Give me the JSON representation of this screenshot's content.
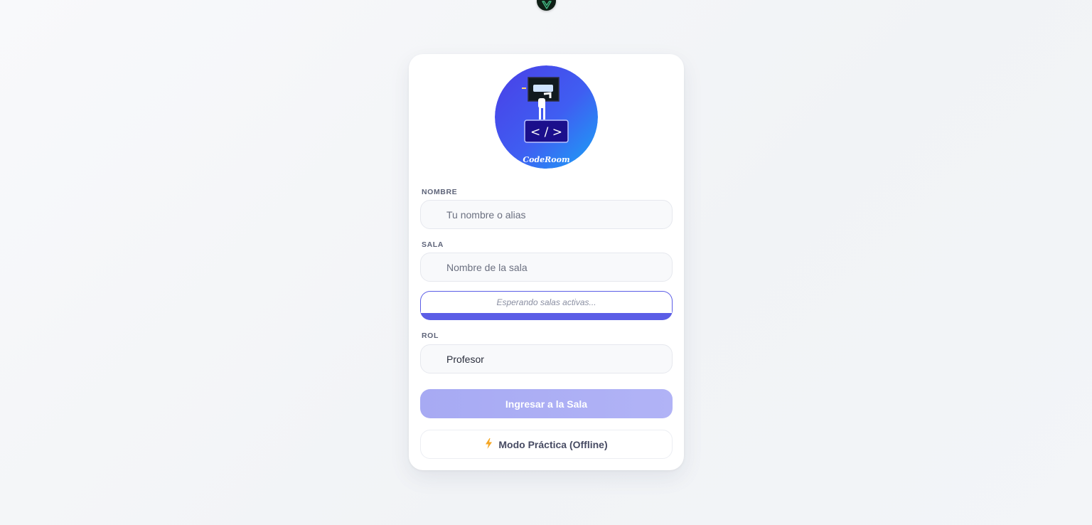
{
  "logo": {
    "text": "CodeRoom",
    "code_symbol": "< / >"
  },
  "form": {
    "name": {
      "label": "NOMBRE",
      "placeholder": "Tu nombre o alias"
    },
    "room": {
      "label": "SALA",
      "placeholder": "Nombre de la sala"
    },
    "rooms_status": "Esperando salas activas...",
    "role": {
      "label": "ROL",
      "value": "Profesor"
    },
    "submit_label": "Ingresar a la Sala",
    "offline_label": "Modo Práctica (Offline)"
  },
  "icons": {
    "top": "vue-logo-icon",
    "offline": "lightning-icon"
  },
  "colors": {
    "accent": "#5b5de6",
    "button_disabled": "#a9acf4",
    "bolt": "#f5a623"
  }
}
